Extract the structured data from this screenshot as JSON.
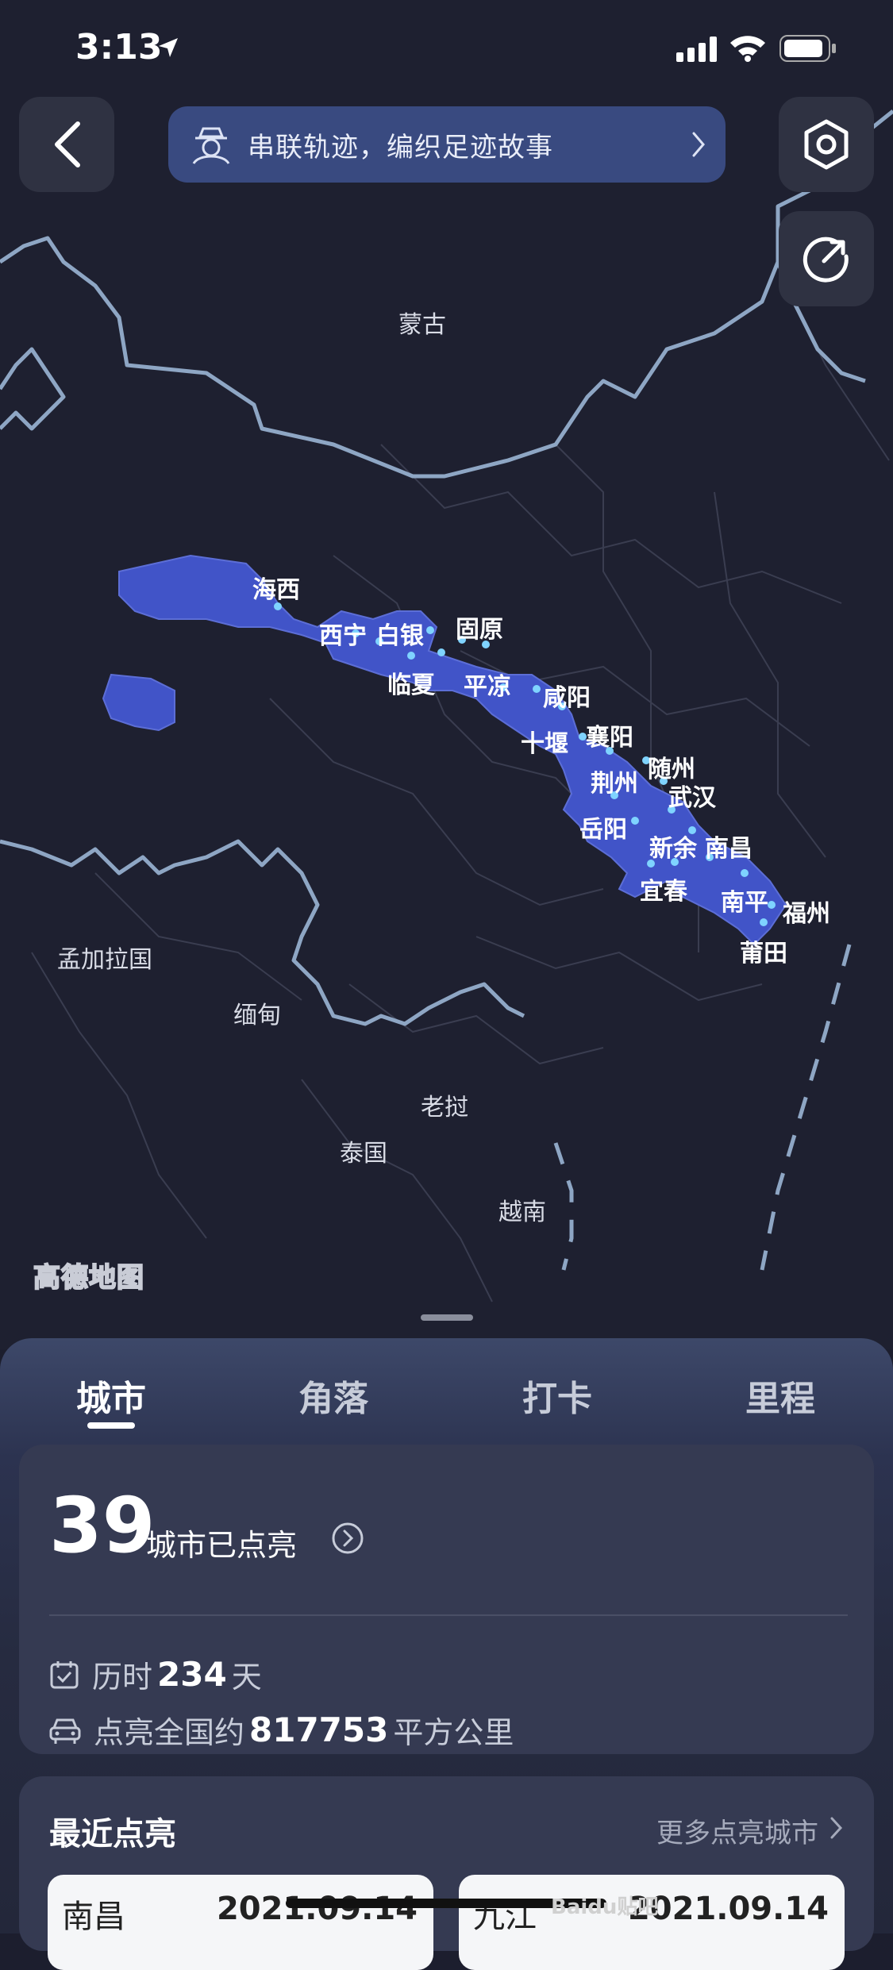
{
  "status_bar": {
    "time": "3:13"
  },
  "banner": {
    "text": "串联轨迹，编织足迹故事"
  },
  "map": {
    "countries": [
      "蒙古",
      "孟加拉国",
      "缅甸",
      "老挝",
      "泰国",
      "越南"
    ],
    "cities": [
      "海西",
      "西宁",
      "白银",
      "固原",
      "临夏",
      "平凉",
      "咸阳",
      "十堰",
      "襄阳",
      "随州",
      "荆州",
      "武汉",
      "岳阳",
      "新余",
      "南昌",
      "宜春",
      "南平",
      "福州",
      "莆田"
    ],
    "watermark": "高德地图",
    "highlight_color": "#4154c8",
    "dot_color": "#7fd3ff"
  },
  "tabs": [
    "城市",
    "角落",
    "打卡",
    "里程"
  ],
  "active_tab": 0,
  "summary": {
    "count": "39",
    "count_label": "城市已点亮",
    "days_prefix": "历时",
    "days": "234",
    "days_suffix": "天",
    "area_prefix": "点亮全国约",
    "area": "817753",
    "area_suffix": "平方公里"
  },
  "recent": {
    "title": "最近点亮",
    "more": "更多点亮城市",
    "items": [
      {
        "name": "南昌",
        "date": "2021.09.14"
      },
      {
        "name": "九江",
        "date": "2021.09.14"
      }
    ]
  },
  "corner_watermark": "Baidu贴吧"
}
